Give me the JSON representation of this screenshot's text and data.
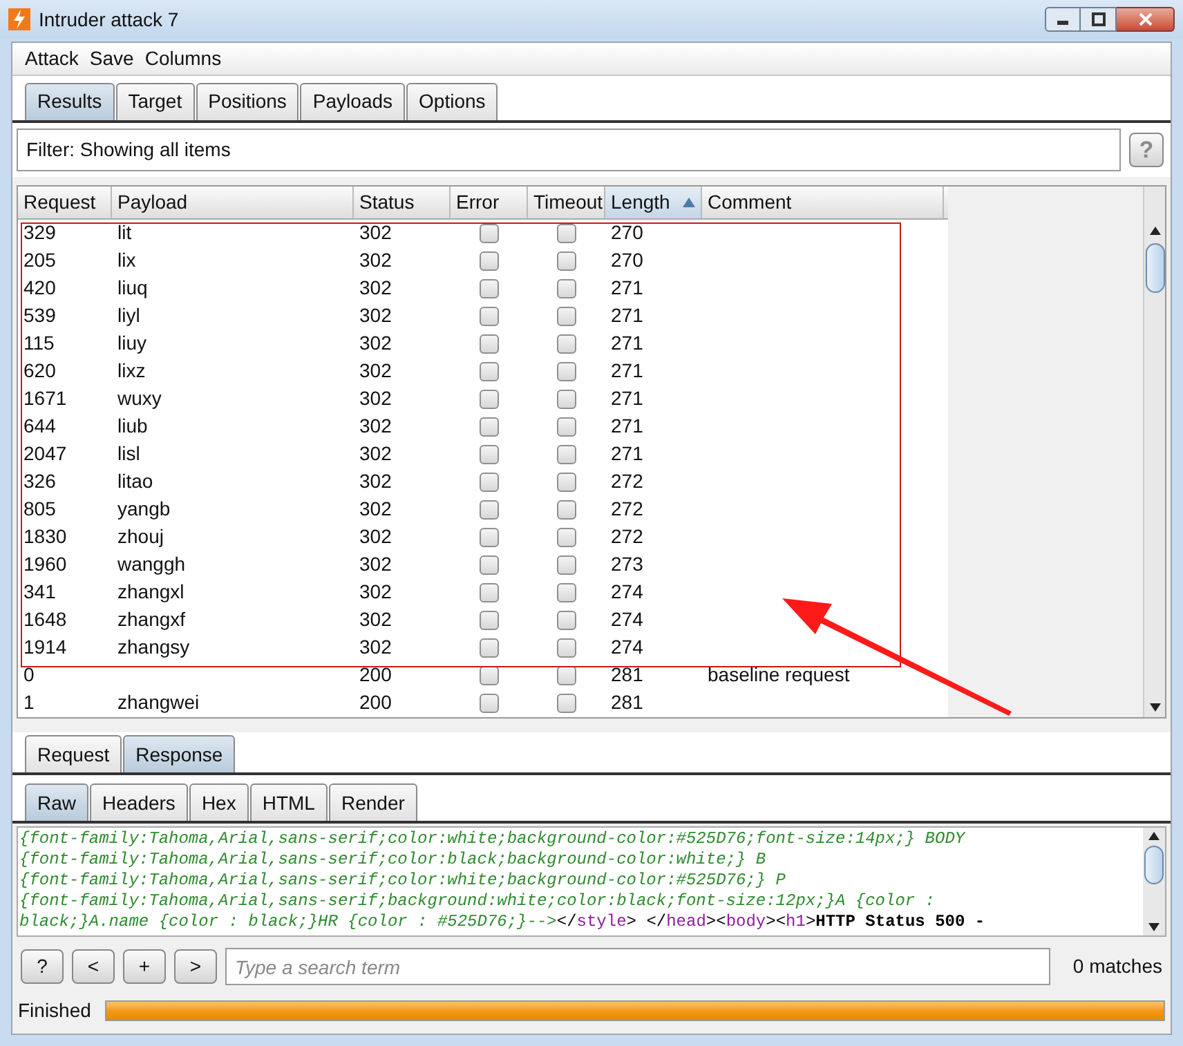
{
  "window": {
    "title": "Intruder attack 7"
  },
  "menu": [
    "Attack",
    "Save",
    "Columns"
  ],
  "tabs": [
    {
      "label": "Results",
      "selected": true
    },
    {
      "label": "Target",
      "selected": false
    },
    {
      "label": "Positions",
      "selected": false
    },
    {
      "label": "Payloads",
      "selected": false
    },
    {
      "label": "Options",
      "selected": false
    }
  ],
  "filter": {
    "text": "Filter: Showing all items",
    "help": "?"
  },
  "table": {
    "columns": [
      {
        "label": "Request",
        "sorted": false
      },
      {
        "label": "Payload",
        "sorted": false
      },
      {
        "label": "Status",
        "sorted": false
      },
      {
        "label": "Error",
        "sorted": false
      },
      {
        "label": "Timeout",
        "sorted": false
      },
      {
        "label": "Length",
        "sorted": true
      },
      {
        "label": "Comment",
        "sorted": false
      }
    ],
    "rows": [
      {
        "request": "329",
        "payload": "lit",
        "status": "302",
        "error": false,
        "timeout": false,
        "length": "270",
        "comment": ""
      },
      {
        "request": "205",
        "payload": "lix",
        "status": "302",
        "error": false,
        "timeout": false,
        "length": "270",
        "comment": ""
      },
      {
        "request": "420",
        "payload": "liuq",
        "status": "302",
        "error": false,
        "timeout": false,
        "length": "271",
        "comment": ""
      },
      {
        "request": "539",
        "payload": "liyl",
        "status": "302",
        "error": false,
        "timeout": false,
        "length": "271",
        "comment": ""
      },
      {
        "request": "115",
        "payload": "liuy",
        "status": "302",
        "error": false,
        "timeout": false,
        "length": "271",
        "comment": ""
      },
      {
        "request": "620",
        "payload": "lixz",
        "status": "302",
        "error": false,
        "timeout": false,
        "length": "271",
        "comment": ""
      },
      {
        "request": "1671",
        "payload": "wuxy",
        "status": "302",
        "error": false,
        "timeout": false,
        "length": "271",
        "comment": ""
      },
      {
        "request": "644",
        "payload": "liub",
        "status": "302",
        "error": false,
        "timeout": false,
        "length": "271",
        "comment": ""
      },
      {
        "request": "2047",
        "payload": "lisl",
        "status": "302",
        "error": false,
        "timeout": false,
        "length": "271",
        "comment": ""
      },
      {
        "request": "326",
        "payload": "litao",
        "status": "302",
        "error": false,
        "timeout": false,
        "length": "272",
        "comment": ""
      },
      {
        "request": "805",
        "payload": "yangb",
        "status": "302",
        "error": false,
        "timeout": false,
        "length": "272",
        "comment": ""
      },
      {
        "request": "1830",
        "payload": "zhouj",
        "status": "302",
        "error": false,
        "timeout": false,
        "length": "272",
        "comment": ""
      },
      {
        "request": "1960",
        "payload": "wanggh",
        "status": "302",
        "error": false,
        "timeout": false,
        "length": "273",
        "comment": ""
      },
      {
        "request": "341",
        "payload": "zhangxl",
        "status": "302",
        "error": false,
        "timeout": false,
        "length": "274",
        "comment": ""
      },
      {
        "request": "1648",
        "payload": "zhangxf",
        "status": "302",
        "error": false,
        "timeout": false,
        "length": "274",
        "comment": ""
      },
      {
        "request": "1914",
        "payload": "zhangsy",
        "status": "302",
        "error": false,
        "timeout": false,
        "length": "274",
        "comment": ""
      },
      {
        "request": "0",
        "payload": "",
        "status": "200",
        "error": false,
        "timeout": false,
        "length": "281",
        "comment": "baseline request"
      },
      {
        "request": "1",
        "payload": "zhangwei",
        "status": "200",
        "error": false,
        "timeout": false,
        "length": "281",
        "comment": ""
      }
    ]
  },
  "message_tabs": [
    {
      "label": "Request",
      "selected": false
    },
    {
      "label": "Response",
      "selected": true
    }
  ],
  "view_tabs": [
    {
      "label": "Raw",
      "selected": true
    },
    {
      "label": "Headers",
      "selected": false
    },
    {
      "label": "Hex",
      "selected": false
    },
    {
      "label": "HTML",
      "selected": false
    },
    {
      "label": "Render",
      "selected": false
    }
  ],
  "code_lines": [
    [
      {
        "kind": "css",
        "text": "{font-family:Tahoma,Arial,sans-serif;color:white;background-color:#525D76;font-size:14px;} BODY"
      }
    ],
    [
      {
        "kind": "css",
        "text": "{font-family:Tahoma,Arial,sans-serif;color:black;background-color:white;} B"
      }
    ],
    [
      {
        "kind": "css",
        "text": "{font-family:Tahoma,Arial,sans-serif;color:white;background-color:#525D76;} P"
      }
    ],
    [
      {
        "kind": "css",
        "text": "{font-family:Tahoma,Arial,sans-serif;background:white;color:black;font-size:12px;}A {color :"
      }
    ],
    [
      {
        "kind": "css",
        "text": "black;}A.name {color : black;}HR {color : #525D76;}-->"
      },
      {
        "kind": "punct",
        "text": "</"
      },
      {
        "kind": "tag",
        "text": "style"
      },
      {
        "kind": "punct",
        "text": "> </"
      },
      {
        "kind": "tag",
        "text": "head"
      },
      {
        "kind": "punct",
        "text": "><"
      },
      {
        "kind": "tag",
        "text": "body"
      },
      {
        "kind": "punct",
        "text": "><"
      },
      {
        "kind": "tag",
        "text": "h1"
      },
      {
        "kind": "punct",
        "text": ">"
      },
      {
        "kind": "content",
        "text": "HTTP Status 500 -"
      }
    ]
  ],
  "search": {
    "buttons": [
      "?",
      "<",
      "+",
      ">"
    ],
    "placeholder": "Type a search term",
    "matches": "0 matches"
  },
  "status": {
    "text": "Finished",
    "level": 1
  }
}
